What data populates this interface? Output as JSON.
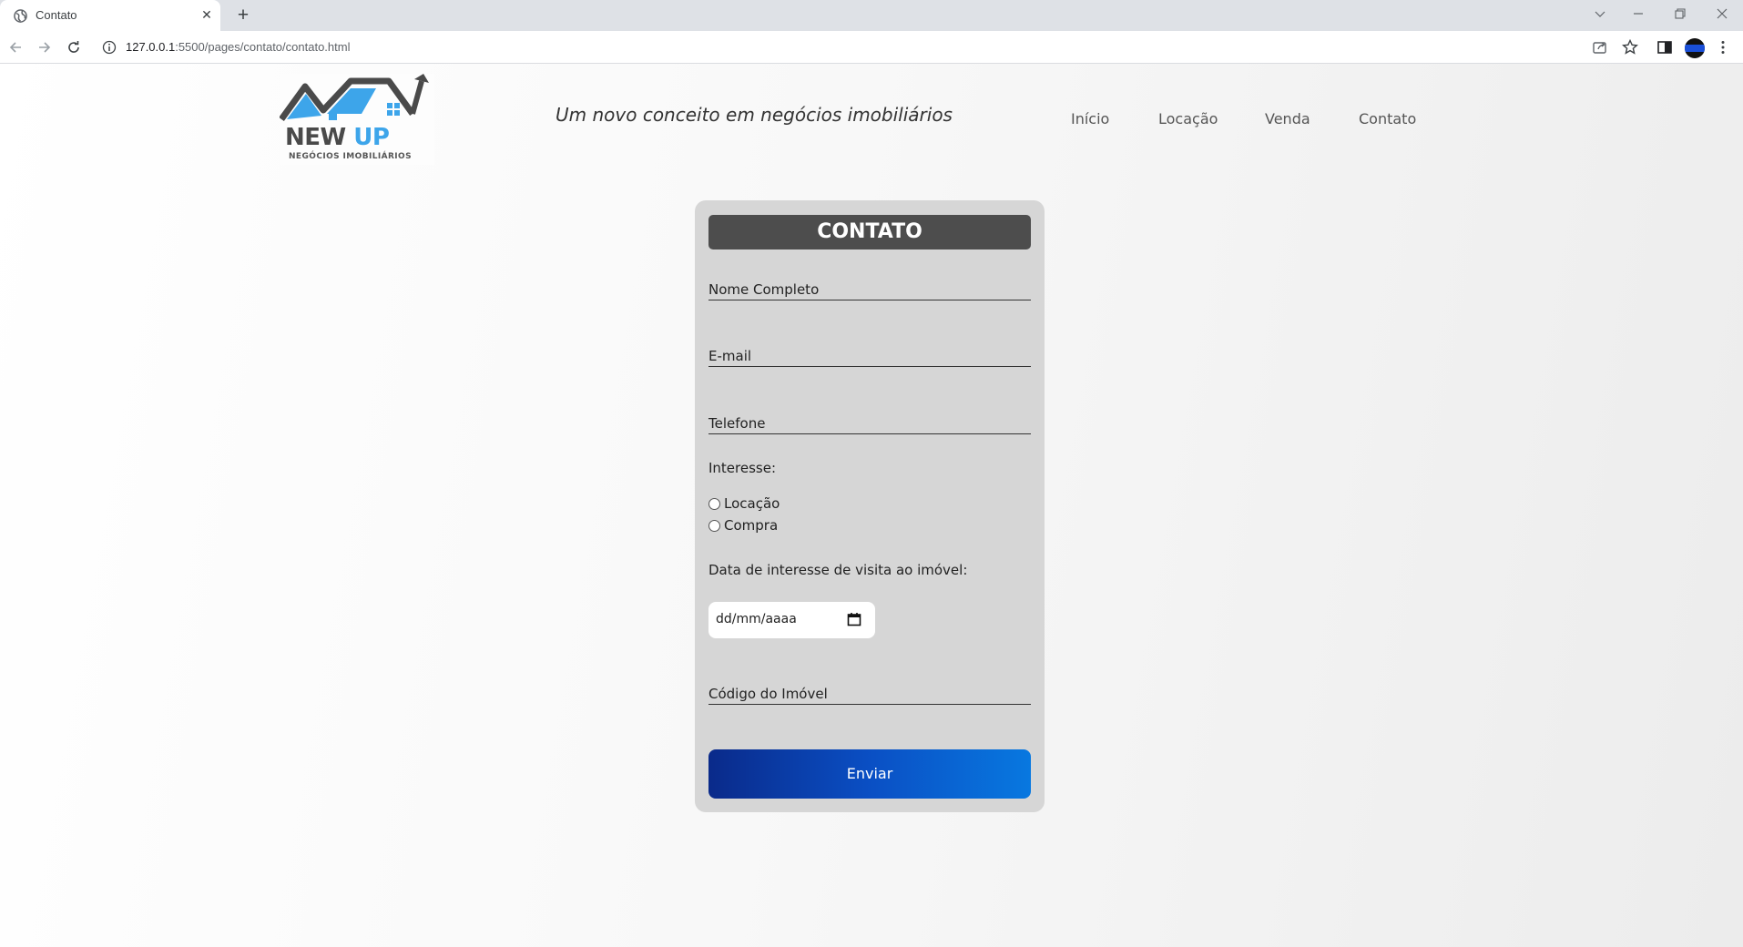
{
  "browser": {
    "tab_title": "Contato",
    "url_host": "127.0.0.1",
    "url_path": ":5500/pages/contato/contato.html"
  },
  "header": {
    "logo_word1": "NEW",
    "logo_word2": "UP",
    "logo_sub": "NEGÓCIOS IMOBILIÁRIOS",
    "slogan": "Um novo conceito em negócios imobiliários"
  },
  "nav": {
    "items": [
      "Início",
      "Locação",
      "Venda",
      "Contato"
    ]
  },
  "form": {
    "title": "CONTATO",
    "name_label": "Nome Completo",
    "email_label": "E-mail",
    "phone_label": "Telefone",
    "interest_label": "Interesse:",
    "options": [
      "Locação",
      "Compra"
    ],
    "date_label": "Data de interesse de visita ao imóvel:",
    "date_placeholder": "dd/mm/aaaa",
    "code_label": "Código do Imóvel",
    "submit_label": "Enviar"
  },
  "colors": {
    "title_bg": "#4d4d4d",
    "card_bg": "#d6d6d6",
    "button_start": "#0a2a8a",
    "button_end": "#0878e0",
    "logo_blue": "#3da5ea"
  }
}
